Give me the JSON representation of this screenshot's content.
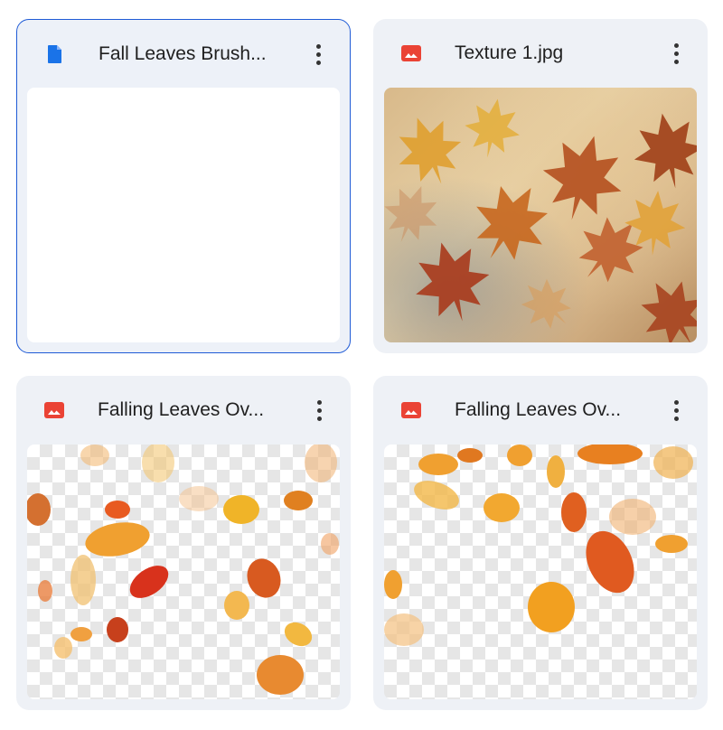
{
  "files": [
    {
      "title": "Fall Leaves Brush...",
      "icon": "doc-icon",
      "icon_color": "#1a73e8",
      "thumbnail": "blank document preview"
    },
    {
      "title": "Texture 1.jpg",
      "icon": "image-icon",
      "icon_color": "#ea4335",
      "thumbnail": "watercolor autumn leaves texture"
    },
    {
      "title": "Falling Leaves Ov...",
      "icon": "image-icon",
      "icon_color": "#ea4335",
      "thumbnail": "falling leaves overlay on transparency"
    },
    {
      "title": "Falling Leaves Ov...",
      "icon": "image-icon",
      "icon_color": "#ea4335",
      "thumbnail": "falling leaves overlay on transparency"
    }
  ],
  "colors": {
    "selection_border": "#1f5bd6",
    "card_bg": "#eef1f6"
  }
}
